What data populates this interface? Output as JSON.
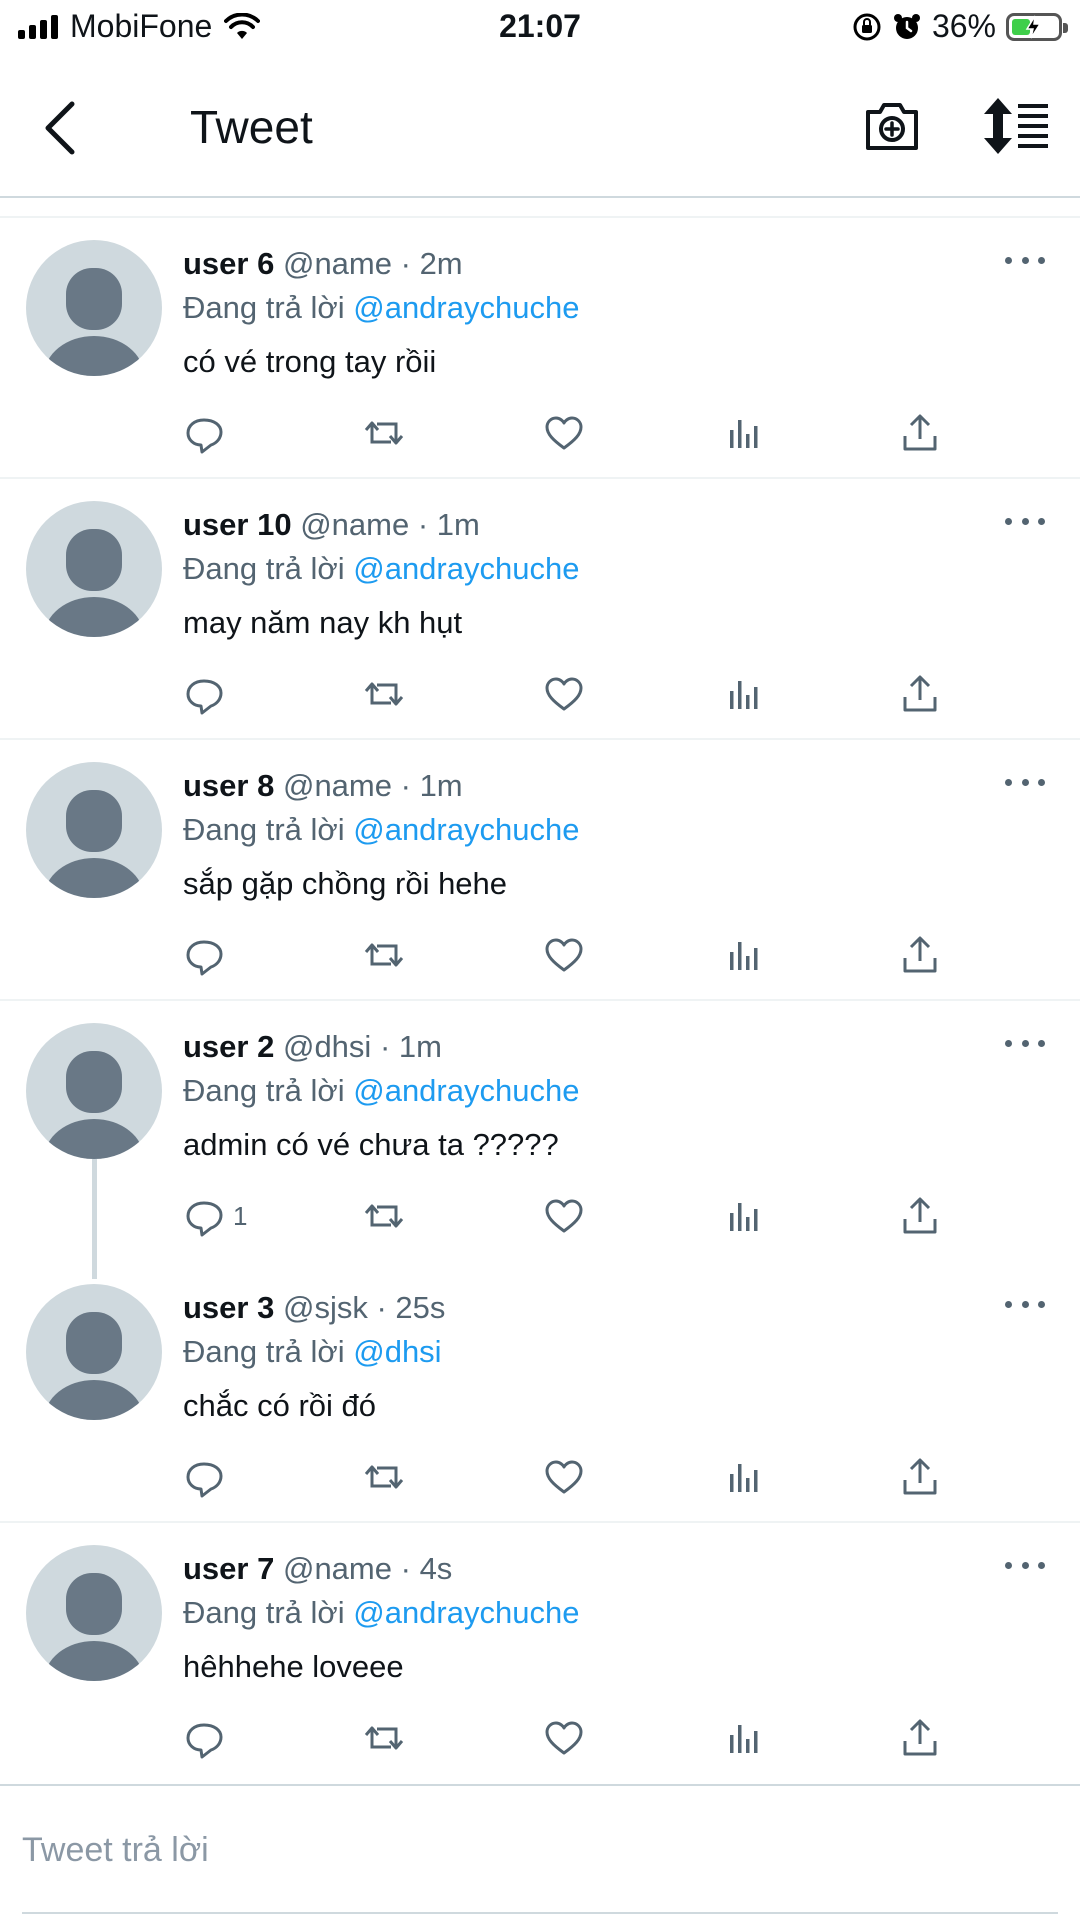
{
  "status_bar": {
    "carrier": "MobiFone",
    "time": "21:07",
    "battery_percent": "36%",
    "battery_level": 0.36,
    "icons": [
      "signal-icon",
      "wifi-icon",
      "rotation-lock-icon",
      "alarm-icon",
      "battery-charging-icon"
    ]
  },
  "header": {
    "title": "Tweet",
    "back_icon": "chevron-left-icon",
    "camera_icon": "camera-add-icon",
    "sort_icon": "sort-replies-icon"
  },
  "colors": {
    "accent": "#1d9bf0",
    "secondary_text": "#536471",
    "divider": "#eff3f4",
    "avatar_bg": "#cfd9de",
    "avatar_fg": "#697886"
  },
  "tweets": [
    {
      "name": "user 6",
      "handle": "@name",
      "dot": "·",
      "time": "2m",
      "reply_prefix": "Đang trả lời ",
      "mention": "@andraychuche",
      "text": "có vé trong tay rồii",
      "reply_count": ""
    },
    {
      "name": "user 10",
      "handle": "@name",
      "dot": "·",
      "time": "1m",
      "reply_prefix": "Đang trả lời ",
      "mention": "@andraychuche",
      "text": "may năm nay kh hụt",
      "reply_count": ""
    },
    {
      "name": "user 8",
      "handle": "@name",
      "dot": "·",
      "time": "1m",
      "reply_prefix": "Đang trả lời ",
      "mention": "@andraychuche",
      "text": "sắp gặp chồng rồi hehe",
      "reply_count": ""
    },
    {
      "name": "user 2",
      "handle": "@dhsi",
      "dot": "·",
      "time": "1m",
      "reply_prefix": "Đang trả lời ",
      "mention": "@andraychuche",
      "text": "admin có vé chưa ta ?????",
      "reply_count": "1"
    },
    {
      "name": "user 3",
      "handle": "@sjsk",
      "dot": "·",
      "time": "25s",
      "reply_prefix": "Đang trả lời ",
      "mention": "@dhsi",
      "text": "chắc có rồi đó",
      "reply_count": ""
    },
    {
      "name": "user 7",
      "handle": "@name",
      "dot": "·",
      "time": "4s",
      "reply_prefix": "Đang trả lời ",
      "mention": "@andraychuche",
      "text": "hêhhehe loveee",
      "reply_count": ""
    }
  ],
  "action_icons": [
    "reply-icon",
    "retweet-icon",
    "like-icon",
    "analytics-icon",
    "share-icon"
  ],
  "reply_box": {
    "placeholder": "Tweet trả lời"
  }
}
